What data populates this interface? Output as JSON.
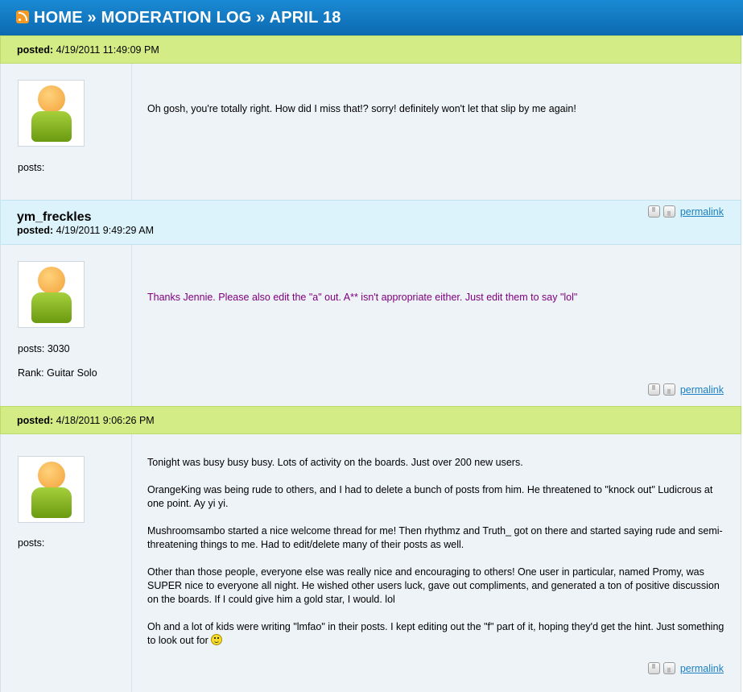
{
  "header": {
    "breadcrumb": "HOME » MODERATION LOG » APRIL 18",
    "icon": "rss-feed-icon"
  },
  "labels": {
    "posted": "posted:",
    "permalink": "permalink"
  },
  "posts": [
    {
      "username": "",
      "timestamp": "4/19/2011 11:49:09 PM",
      "header_color": "#d4ec86",
      "stats": [
        "posts:"
      ],
      "message": [
        "Oh gosh, you're totally right. How did I miss that!? sorry! definitely won't let that slip by me again!"
      ]
    },
    {
      "username": "ym_freckles",
      "timestamp": "4/19/2011 9:49:29 AM",
      "header_color": "#dcf3fb",
      "message_color": "#800080",
      "stats": [
        "posts: 3030",
        "Rank: Guitar Solo"
      ],
      "message": [
        "Thanks Jennie. Please also edit the \"a\" out. A** isn't appropriate either. Just edit them to say \"lol\""
      ]
    },
    {
      "username": "",
      "timestamp": "4/18/2011 9:06:26 PM",
      "header_color": "#d4ec86",
      "stats": [
        "posts:"
      ],
      "message": [
        "Tonight was busy busy busy. Lots of activity on the boards. Just over 200 new users.",
        "OrangeKing was being rude to others, and I had to delete a bunch of posts from him. He threatened to \"knock out\" Ludicrous at one point. Ay yi yi.",
        "Mushroomsambo started a nice welcome thread for me! Then rhythmz and Truth_ got on there and started saying rude and semi-threatening things to me. Had to edit/delete many of their posts as well.",
        "Other than those people, everyone else was really nice and encouraging to others! One user in particular, named Promy, was SUPER nice to everyone all night. He wished other users luck, gave out compliments, and generated a ton of positive discussion on the boards. If I could give him a gold star, I would. lol",
        "Oh and a lot of kids were writing \"lmfao\" in their posts. I kept editing out the \"f\" part of it, hoping they'd get the hint. Just something to look out for"
      ],
      "emoticon": "smiley-icon"
    }
  ]
}
